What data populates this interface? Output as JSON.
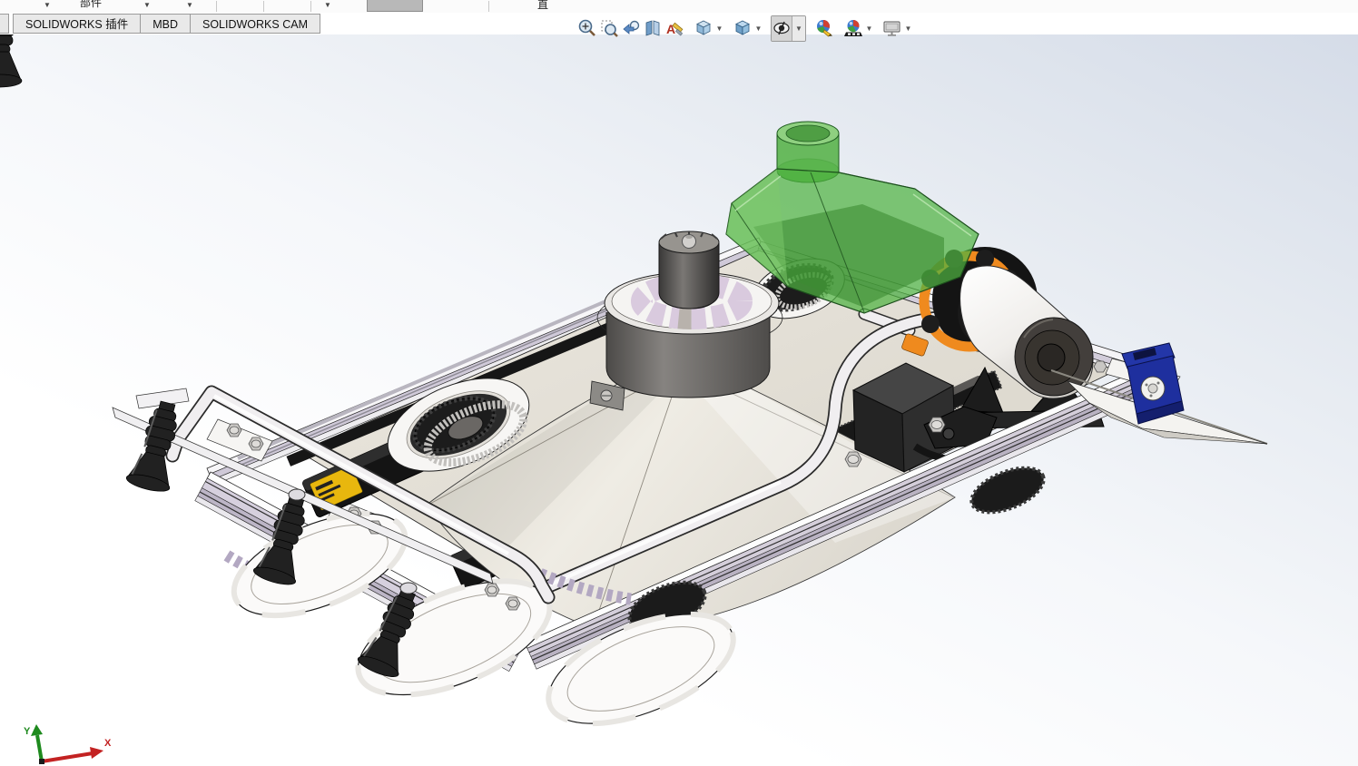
{
  "app": {
    "name": "SOLIDWORKS"
  },
  "command_manager_strip": {
    "partial_label_1": "部件",
    "partial_label_2": "直",
    "caret_glyph": "▼"
  },
  "tabs": [
    {
      "label": "SOLIDWORKS 插件"
    },
    {
      "label": "MBD"
    },
    {
      "label": "SOLIDWORKS CAM"
    }
  ],
  "heads_up_toolbar": {
    "icons": [
      "zoom-to-fit",
      "zoom-to-area",
      "previous-view",
      "section-view",
      "dynamic-annotation-views",
      "view-orientation",
      "display-style",
      "hide-show-items",
      "edit-appearance",
      "apply-scene",
      "view-settings"
    ],
    "caret_glyph": "▼",
    "pressed_item": "hide-show-items"
  },
  "viewport": {
    "background_top_color": "#d5dce8",
    "background_bottom_color": "#ffffff",
    "triad": {
      "x_label": "X",
      "y_label": "Y",
      "x_color": "#cc2222",
      "y_color": "#1e8a1e"
    }
  },
  "model": {
    "description": "3D assembly of a wheeled cleaning-robot chassis on aluminum extrusion frame",
    "components": [
      "extrusion-frame",
      "deck",
      "spreader-cone",
      "center-drum",
      "spoked-impeller",
      "top-motor",
      "green-hopper",
      "hopper-neck",
      "flange-coupling",
      "white-pump-motor",
      "stepper-box",
      "servo-blue",
      "skid-blade",
      "suction-bellows",
      "white-tubing",
      "brush-discs",
      "wheel-left",
      "wheel-rear",
      "esc-batteries"
    ],
    "colors": {
      "hopper_green": "#4fb341",
      "hopper_dark": "#2f7d2f",
      "servo_blue": "#1e2f9e",
      "coupling_orange": "#ef8a1e",
      "label_yellow": "#e8b70e",
      "tire_black": "#1c1c1c",
      "frame_white": "#f6f5f7",
      "frame_shadow": "#cfc9d8",
      "deck_beige": "#e3dfd6"
    }
  }
}
